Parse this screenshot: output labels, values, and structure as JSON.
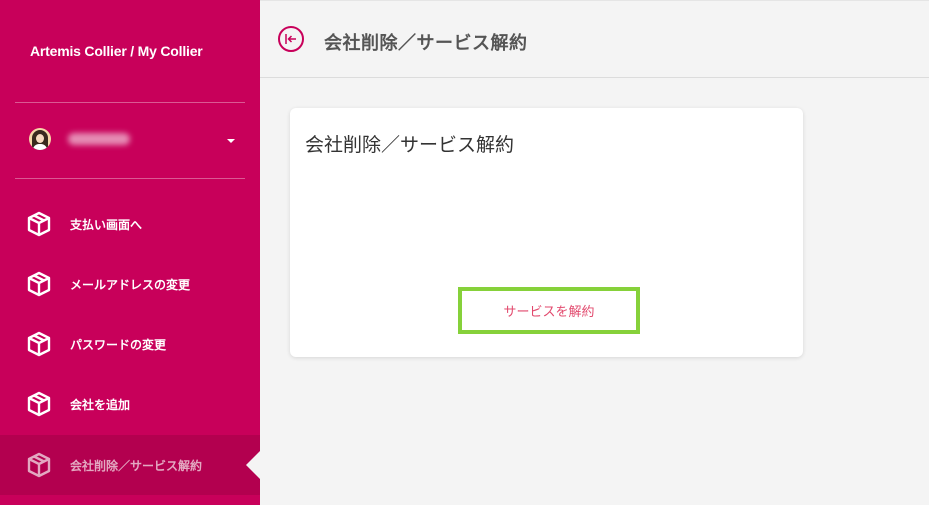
{
  "sidebar": {
    "brand": "Artemis Collier / My Collier",
    "nav": [
      {
        "label": "支払い画面へ",
        "icon": "box-icon"
      },
      {
        "label": "メールアドレスの変更",
        "icon": "box-icon"
      },
      {
        "label": "パスワードの変更",
        "icon": "box-icon"
      },
      {
        "label": "会社を追加",
        "icon": "box-icon"
      },
      {
        "label": "会社削除／サービス解約",
        "icon": "box-icon",
        "active": true
      }
    ]
  },
  "header": {
    "title": "会社削除／サービス解約",
    "back_icon": "back-arrow-icon"
  },
  "card": {
    "title": "会社削除／サービス解約",
    "button_label": "サービスを解約"
  },
  "colors": {
    "brand": "#c8005a",
    "highlight": "#86d13a",
    "button_text": "#e24a6e"
  }
}
